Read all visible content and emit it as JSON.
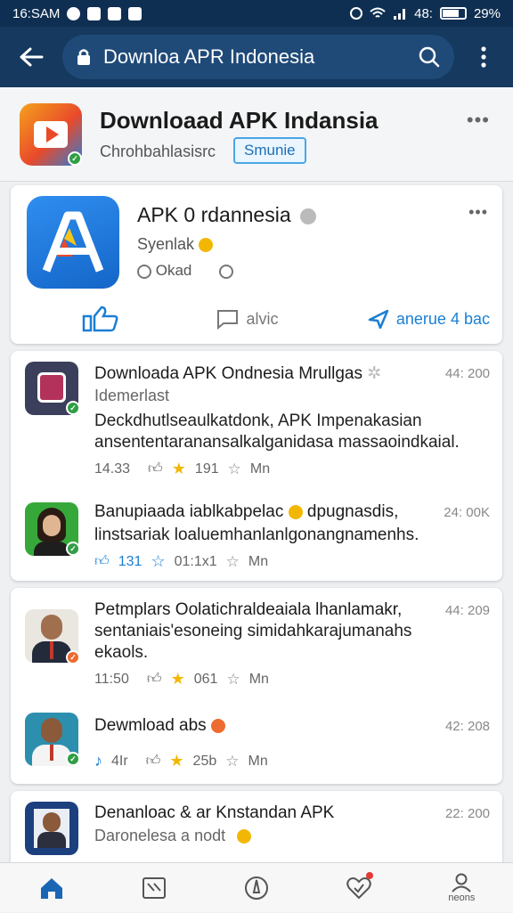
{
  "status": {
    "time": "16:SAM",
    "signal": "48:",
    "battery": "29%"
  },
  "appbar": {
    "url": "Downloa APR Indonesia"
  },
  "header": {
    "title": "Downloaad APK Indansia",
    "subtitle": "Chrohbahlasisrc",
    "pill": "Smunie"
  },
  "app_card": {
    "title": "APK 0 rdannesia",
    "meta1": "Syenlak",
    "meta2": "Okad",
    "actions": [
      {
        "label": ""
      },
      {
        "label": "alvic"
      },
      {
        "label": "anerue 4 bac"
      }
    ]
  },
  "posts": [
    {
      "name": "Downloada APK Ondnesia Mrullgas",
      "time": "44: 200",
      "sub": "Idemerlast",
      "lines": [
        "Deckdhutlseaulkatdonk, APK Impenakasian",
        "ansententaranansalkalganidasa massaoindkaial."
      ],
      "stats": [
        "14.33",
        "191",
        "Mn"
      ]
    },
    {
      "name": "Banupiaada iablkabpelac",
      "name_suffix": "dpugnasdis,",
      "time": "24: 00K",
      "lines": [
        "linstsariak loaluemhanlanlgonangnamenhs."
      ],
      "stats": [
        "131",
        "01:1x1",
        "Mn"
      ]
    },
    {
      "name": "Petmplars Oolatichraldeaiala lhanlamakr,",
      "time": "44: 209",
      "lines": [
        "sentaniais'esoneing simidahkarajumanahs",
        "ekaols."
      ],
      "stats": [
        "11:50",
        "061",
        "Mn"
      ]
    },
    {
      "name": "Dewmload abs",
      "time": "42: 208",
      "lines": [],
      "stats": [
        "4Ir",
        "25b",
        "Mn"
      ]
    },
    {
      "name": "Denanloac & ar Knstandan APK",
      "time": "22: 200",
      "sub": "Daronelesa a nodt",
      "lines": [],
      "stats": []
    }
  ],
  "bottomnav": {
    "items": [
      {
        "label": ""
      },
      {
        "label": ""
      },
      {
        "label": ""
      },
      {
        "label": ""
      },
      {
        "label": "neons"
      }
    ]
  },
  "colors": {
    "appbar": "#15395f",
    "accent": "#1a7fd4",
    "verified": "#2f9e44",
    "star": "#f2b705"
  }
}
